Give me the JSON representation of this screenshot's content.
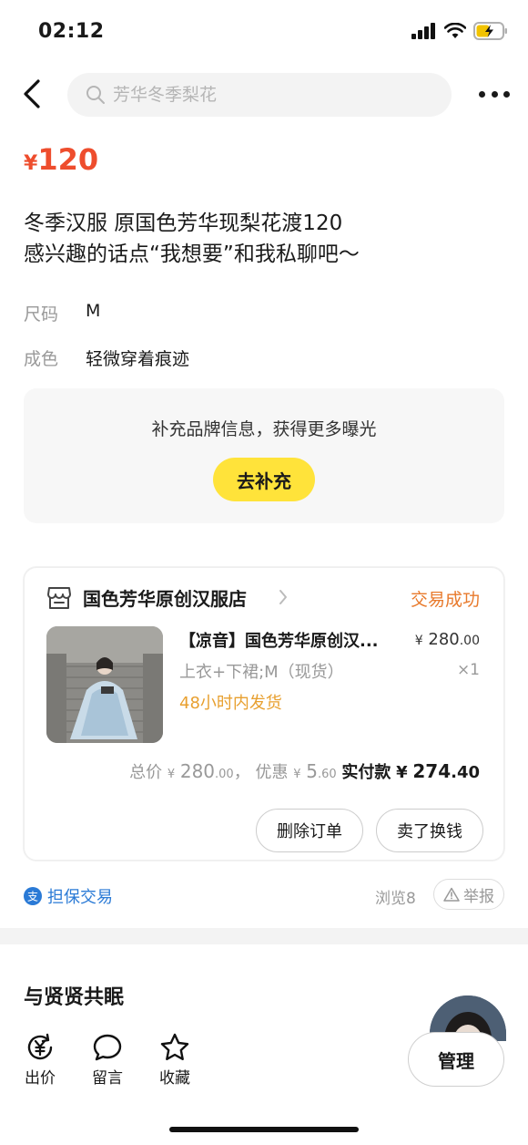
{
  "status_bar": {
    "time": "02:12"
  },
  "search": {
    "placeholder": "芳华冬季梨花"
  },
  "item": {
    "currency": "¥",
    "price": "120",
    "desc_line1": "冬季汉服 原国色芳华现梨花渡120",
    "desc_line2": "感兴趣的话点“我想要”和我私聊吧～",
    "attrs": [
      {
        "key": "尺码",
        "value": "M"
      },
      {
        "key": "成色",
        "value": "轻微穿着痕迹"
      }
    ]
  },
  "brand_prompt": {
    "text": "补充品牌信息，获得更多曝光",
    "button": "去补充"
  },
  "order": {
    "shop_name": "国色芳华原创汉服店",
    "status": "交易成功",
    "product_title": "【凉音】国色芳华原创汉...",
    "price_currency": "¥",
    "price_int": "280",
    "price_dec": ".00",
    "spec": "上衣+下裙;M（现货）",
    "qty": "×1",
    "ship_note": "48小时内发货",
    "total_label": "总价",
    "total_cur": "¥",
    "total_int": "280",
    "total_dec": ".00",
    "sep": "，",
    "discount_label": "优惠",
    "discount_cur": "¥",
    "discount_int": "5",
    "discount_dec": ".60",
    "paid_label": "实付款",
    "paid_cur": "¥",
    "paid_int": "274",
    "paid_dec": ".40",
    "btn_delete": "删除订单",
    "btn_resell": "卖了换钱"
  },
  "footer_info": {
    "guarantee": "担保交易",
    "views": "浏览8",
    "report": "举报"
  },
  "section": {
    "title": "与贤贤共眠"
  },
  "bottom_bar": {
    "offer": "出价",
    "comment": "留言",
    "favorite": "收藏",
    "manage": "管理"
  },
  "colors": {
    "price": "#ee4d2d",
    "accent_yellow": "#ffe33a",
    "status_orange": "#e87a2c",
    "link_blue": "#2a7ad6"
  }
}
